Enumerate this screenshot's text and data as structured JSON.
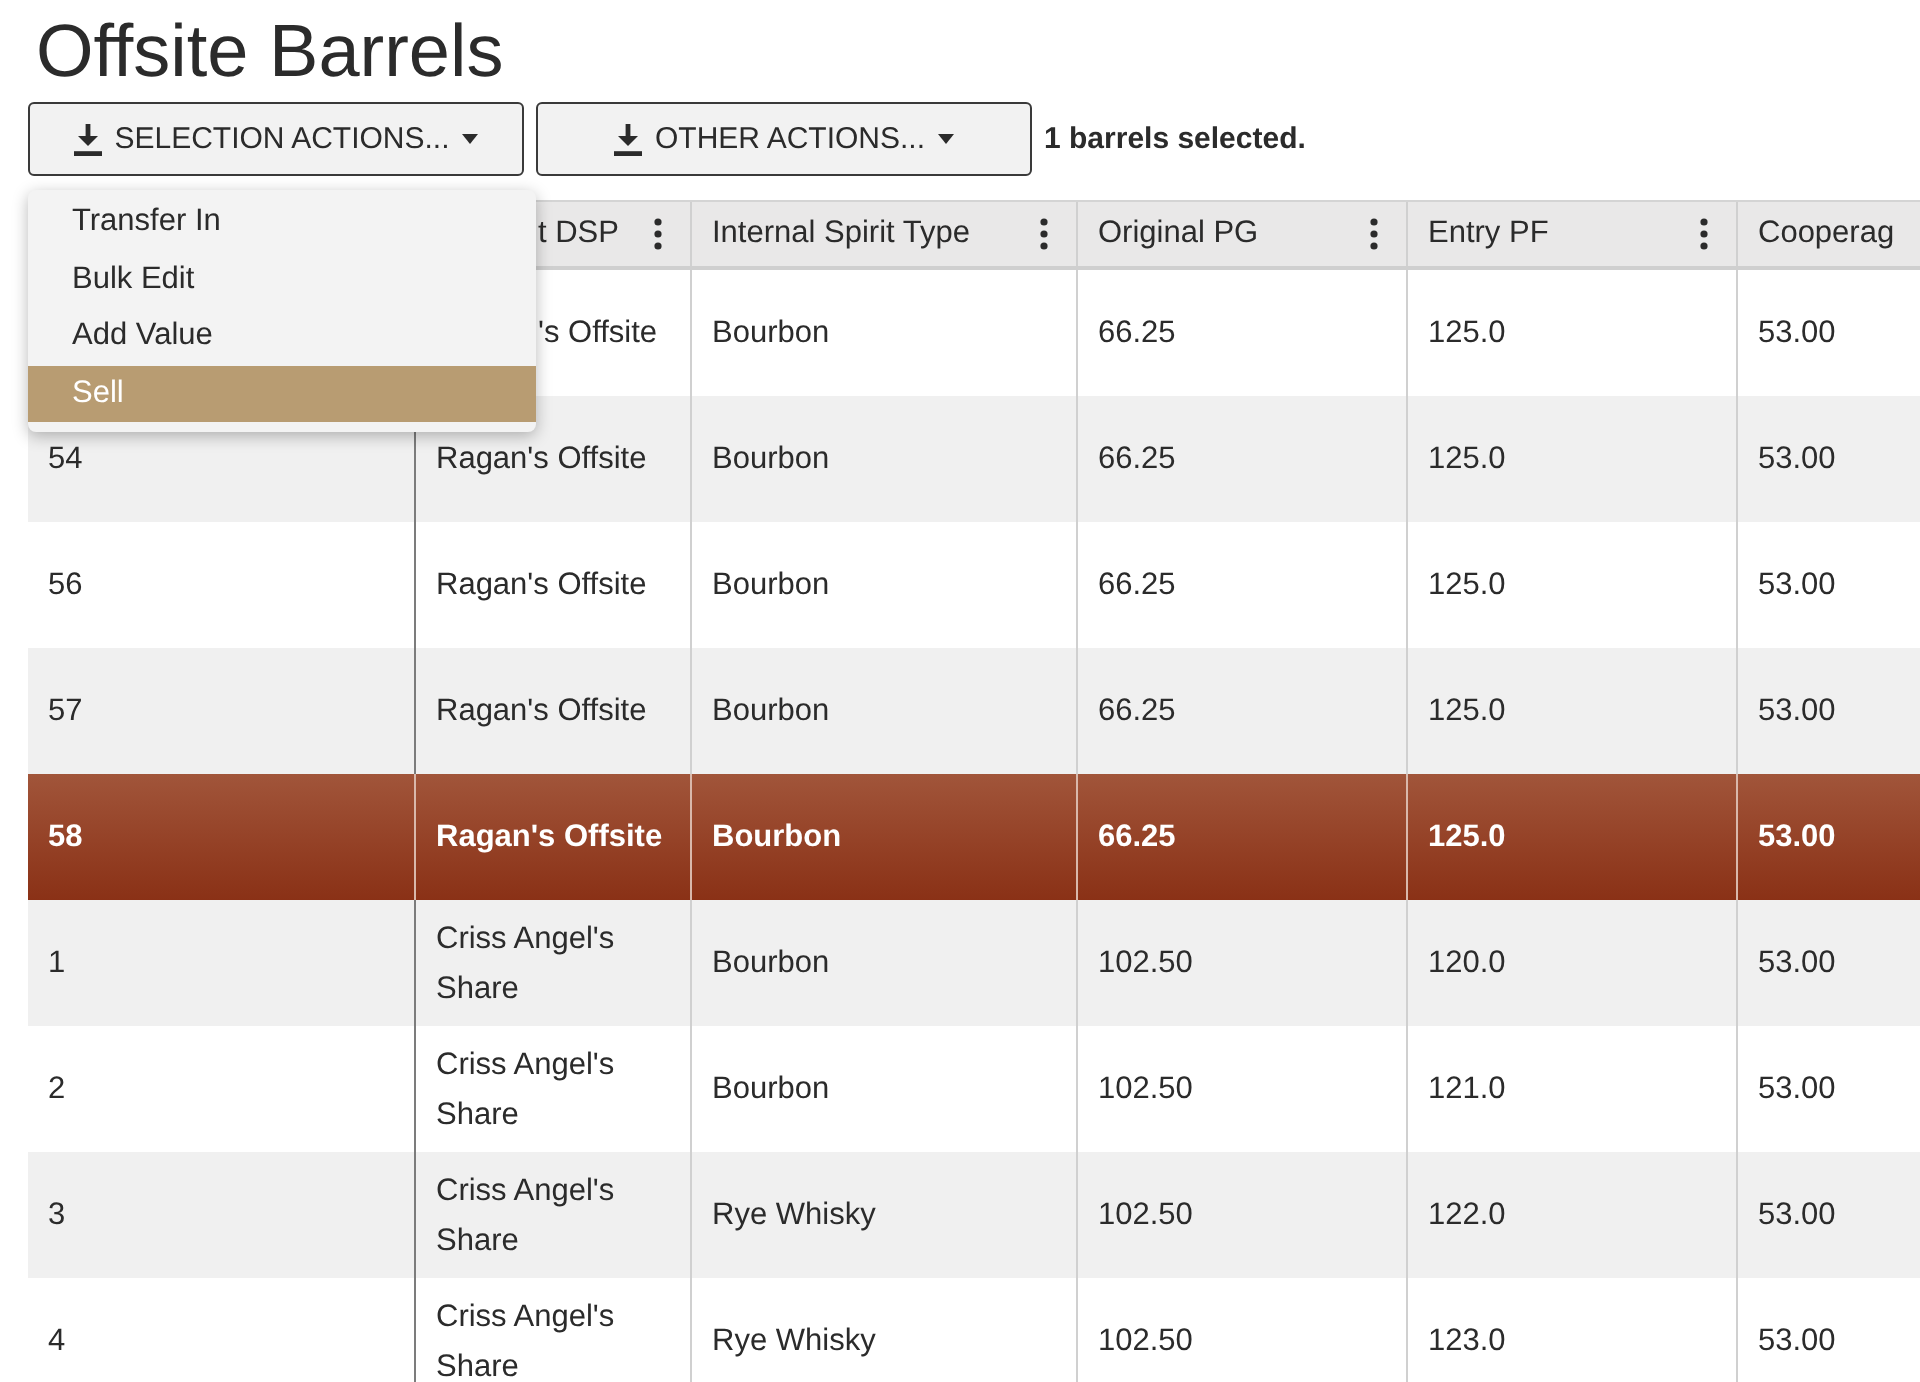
{
  "page": {
    "title": "Offsite Barrels"
  },
  "toolbar": {
    "buttons": [
      {
        "label": "SELECTION ACTIONS..."
      },
      {
        "label": "OTHER ACTIONS..."
      }
    ],
    "status": "1 barrels selected."
  },
  "menu": {
    "items": [
      {
        "label": "Transfer In",
        "selected": false
      },
      {
        "label": "Bulk Edit",
        "selected": false
      },
      {
        "label": "Add Value",
        "selected": false
      },
      {
        "label": "Sell",
        "selected": true
      }
    ]
  },
  "table": {
    "columns": [
      {
        "label": "t DSP",
        "cut_at_start": true,
        "menu_icon": true
      },
      {
        "label": "Internal Spirit Type",
        "cut_at_start": false,
        "menu_icon": true
      },
      {
        "label": "Original PG",
        "cut_at_start": false,
        "menu_icon": true
      },
      {
        "label": "Entry PF",
        "cut_at_start": false,
        "menu_icon": true
      },
      {
        "label": "Cooperag",
        "cut_at_start": false,
        "menu_icon": false
      }
    ],
    "rows": [
      {
        "selected": false,
        "cut_at_start": true,
        "cells": [
          "'s Offsite",
          "Bourbon",
          "66.25",
          "125.0",
          "53.00"
        ]
      },
      {
        "selected": false,
        "cut_at_start": false,
        "number": "54",
        "cells": [
          "Ragan's Offsite",
          "Bourbon",
          "66.25",
          "125.0",
          "53.00"
        ]
      },
      {
        "selected": false,
        "cut_at_start": false,
        "number": "56",
        "cells": [
          "Ragan's Offsite",
          "Bourbon",
          "66.25",
          "125.0",
          "53.00"
        ]
      },
      {
        "selected": false,
        "cut_at_start": false,
        "number": "57",
        "cells": [
          "Ragan's Offsite",
          "Bourbon",
          "66.25",
          "125.0",
          "53.00"
        ]
      },
      {
        "selected": true,
        "cut_at_start": false,
        "number": "58",
        "cells": [
          "Ragan's Offsite",
          "Bourbon",
          "66.25",
          "125.0",
          "53.00"
        ]
      },
      {
        "selected": false,
        "cut_at_start": false,
        "number": "1",
        "cells": [
          "Criss Angel's Share",
          "Bourbon",
          "102.50",
          "120.0",
          "53.00"
        ]
      },
      {
        "selected": false,
        "cut_at_start": false,
        "number": "2",
        "cells": [
          "Criss Angel's Share",
          "Bourbon",
          "102.50",
          "121.0",
          "53.00"
        ]
      },
      {
        "selected": false,
        "cut_at_start": false,
        "number": "3",
        "cells": [
          "Criss Angel's Share",
          "Rye Whisky",
          "102.50",
          "122.0",
          "53.00"
        ]
      },
      {
        "selected": false,
        "cut_at_start": false,
        "number": "4",
        "cells": [
          "Criss Angel's Share",
          "Rye Whisky",
          "102.50",
          "123.0",
          "53.00"
        ]
      }
    ]
  }
}
